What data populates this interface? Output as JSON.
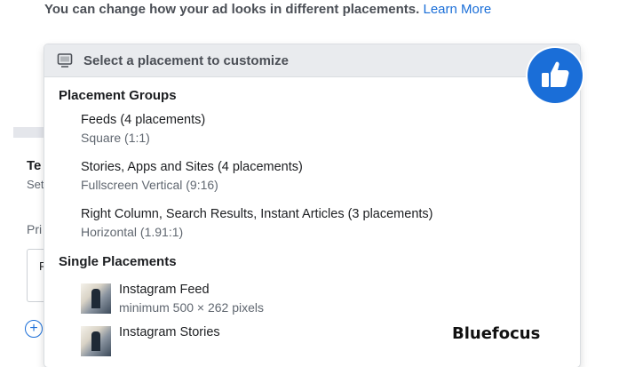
{
  "intro": {
    "text": "You can change how your ad looks in different placements.",
    "link": "Learn More"
  },
  "background": {
    "title": "Te",
    "subtitle": "Set",
    "label": "Pri",
    "box_char": "F",
    "add_icon": "plus-circle-icon"
  },
  "dropdown": {
    "header": "Select a placement to customize",
    "header_icon": "monitor-icon",
    "groups_heading": "Placement Groups",
    "groups": [
      {
        "name": "Feeds (4 placements)",
        "detail": "Square (1:1)"
      },
      {
        "name": "Stories, Apps and Sites (4 placements)",
        "detail": "Fullscreen Vertical (9:16)"
      },
      {
        "name": "Right Column, Search Results, Instant Articles (3 placements)",
        "detail": "Horizontal (1.91:1)"
      }
    ],
    "single_heading": "Single Placements",
    "singles": [
      {
        "name": "Instagram Feed",
        "detail": "minimum 500 × 262 pixels"
      },
      {
        "name": "Instagram Stories",
        "detail": ""
      }
    ]
  },
  "overlay": {
    "badge_icon": "thumbs-up-icon",
    "watermark": "Bluefocus"
  },
  "colors": {
    "accent": "#1a6ed8",
    "header_bg": "#e9ebee",
    "muted_text": "#606770"
  }
}
